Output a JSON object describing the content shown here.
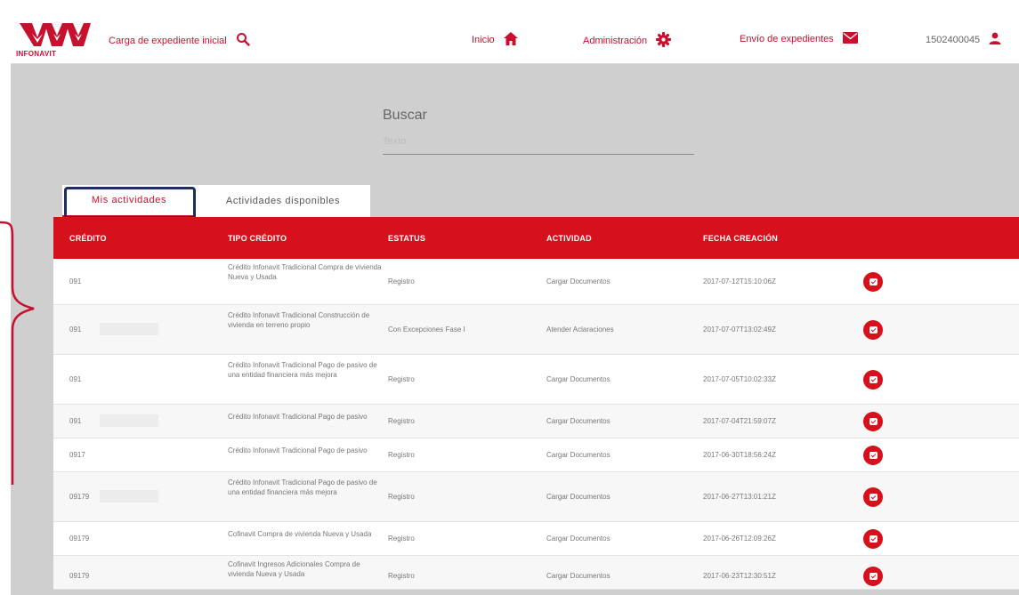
{
  "header": {
    "logo_text": "INFONAVIT",
    "nav": {
      "carga": "Carga de expediente inicial",
      "inicio": "Inicio",
      "administracion": "Administración",
      "envio": "Envío de expedientes",
      "user": "1502400045"
    }
  },
  "search": {
    "label": "Buscar",
    "placeholder": "Texto"
  },
  "tabs": {
    "mis": "Mis actividades",
    "disponibles": "Actividades disponibles"
  },
  "table": {
    "columns": {
      "credito": "CRÉDITO",
      "tipo": "TIPO CRÉDITO",
      "estatus": "ESTATUS",
      "actividad": "ACTIVIDAD",
      "fecha": "FECHA CREACIÓN"
    },
    "rows": [
      {
        "credito": "091",
        "tipo": "Crédito Infonavit Tradicional Compra de vivienda Nueva y Usada",
        "estatus": "Registro",
        "actividad": "Cargar Documentos",
        "fecha": "2017-07-12T15:10:06Z"
      },
      {
        "credito": "091",
        "tipo": "Crédito Infonavit Tradicional Construcción de vivienda en terreno propio",
        "estatus": "Con Excepciones Fase I",
        "actividad": "Atender Aclaraciones",
        "fecha": "2017-07-07T13:02:49Z"
      },
      {
        "credito": "091",
        "tipo": "Crédito Infonavit Tradicional Pago de pasivo de una entidad financiera más mejora",
        "estatus": "Registro",
        "actividad": "Cargar Documentos",
        "fecha": "2017-07-05T10:02:33Z"
      },
      {
        "credito": "091",
        "tipo": "Crédito Infonavit Tradicional Pago de pasivo",
        "estatus": "Registro",
        "actividad": "Cargar Documentos",
        "fecha": "2017-07-04T21:59:07Z"
      },
      {
        "credito": "0917",
        "tipo": "Crédito Infonavit Tradicional Pago de pasivo",
        "estatus": "Registro",
        "actividad": "Cargar Documentos",
        "fecha": "2017-06-30T18:56:24Z"
      },
      {
        "credito": "09179",
        "tipo": "Crédito Infonavit Tradicional Pago de pasivo de una entidad financiera más mejora",
        "estatus": "Registro",
        "actividad": "Cargar Documentos",
        "fecha": "2017-06-27T13:01:21Z"
      },
      {
        "credito": "09179",
        "tipo": "Cofinavit Compra de vivienda Nueva y Usada",
        "estatus": "Registro",
        "actividad": "Cargar Documentos",
        "fecha": "2017-06-26T12:09:26Z"
      },
      {
        "credito": "09179",
        "tipo": "Cofinavit Ingresos Adicionales Compra de vivienda Nueva y Usada",
        "estatus": "Registro",
        "actividad": "Cargar Documentos",
        "fecha": "2017-06-23T12:30:51Z"
      }
    ]
  },
  "colors": {
    "brand_red": "#d7111b",
    "highlight_navy": "#1f2d5c"
  }
}
